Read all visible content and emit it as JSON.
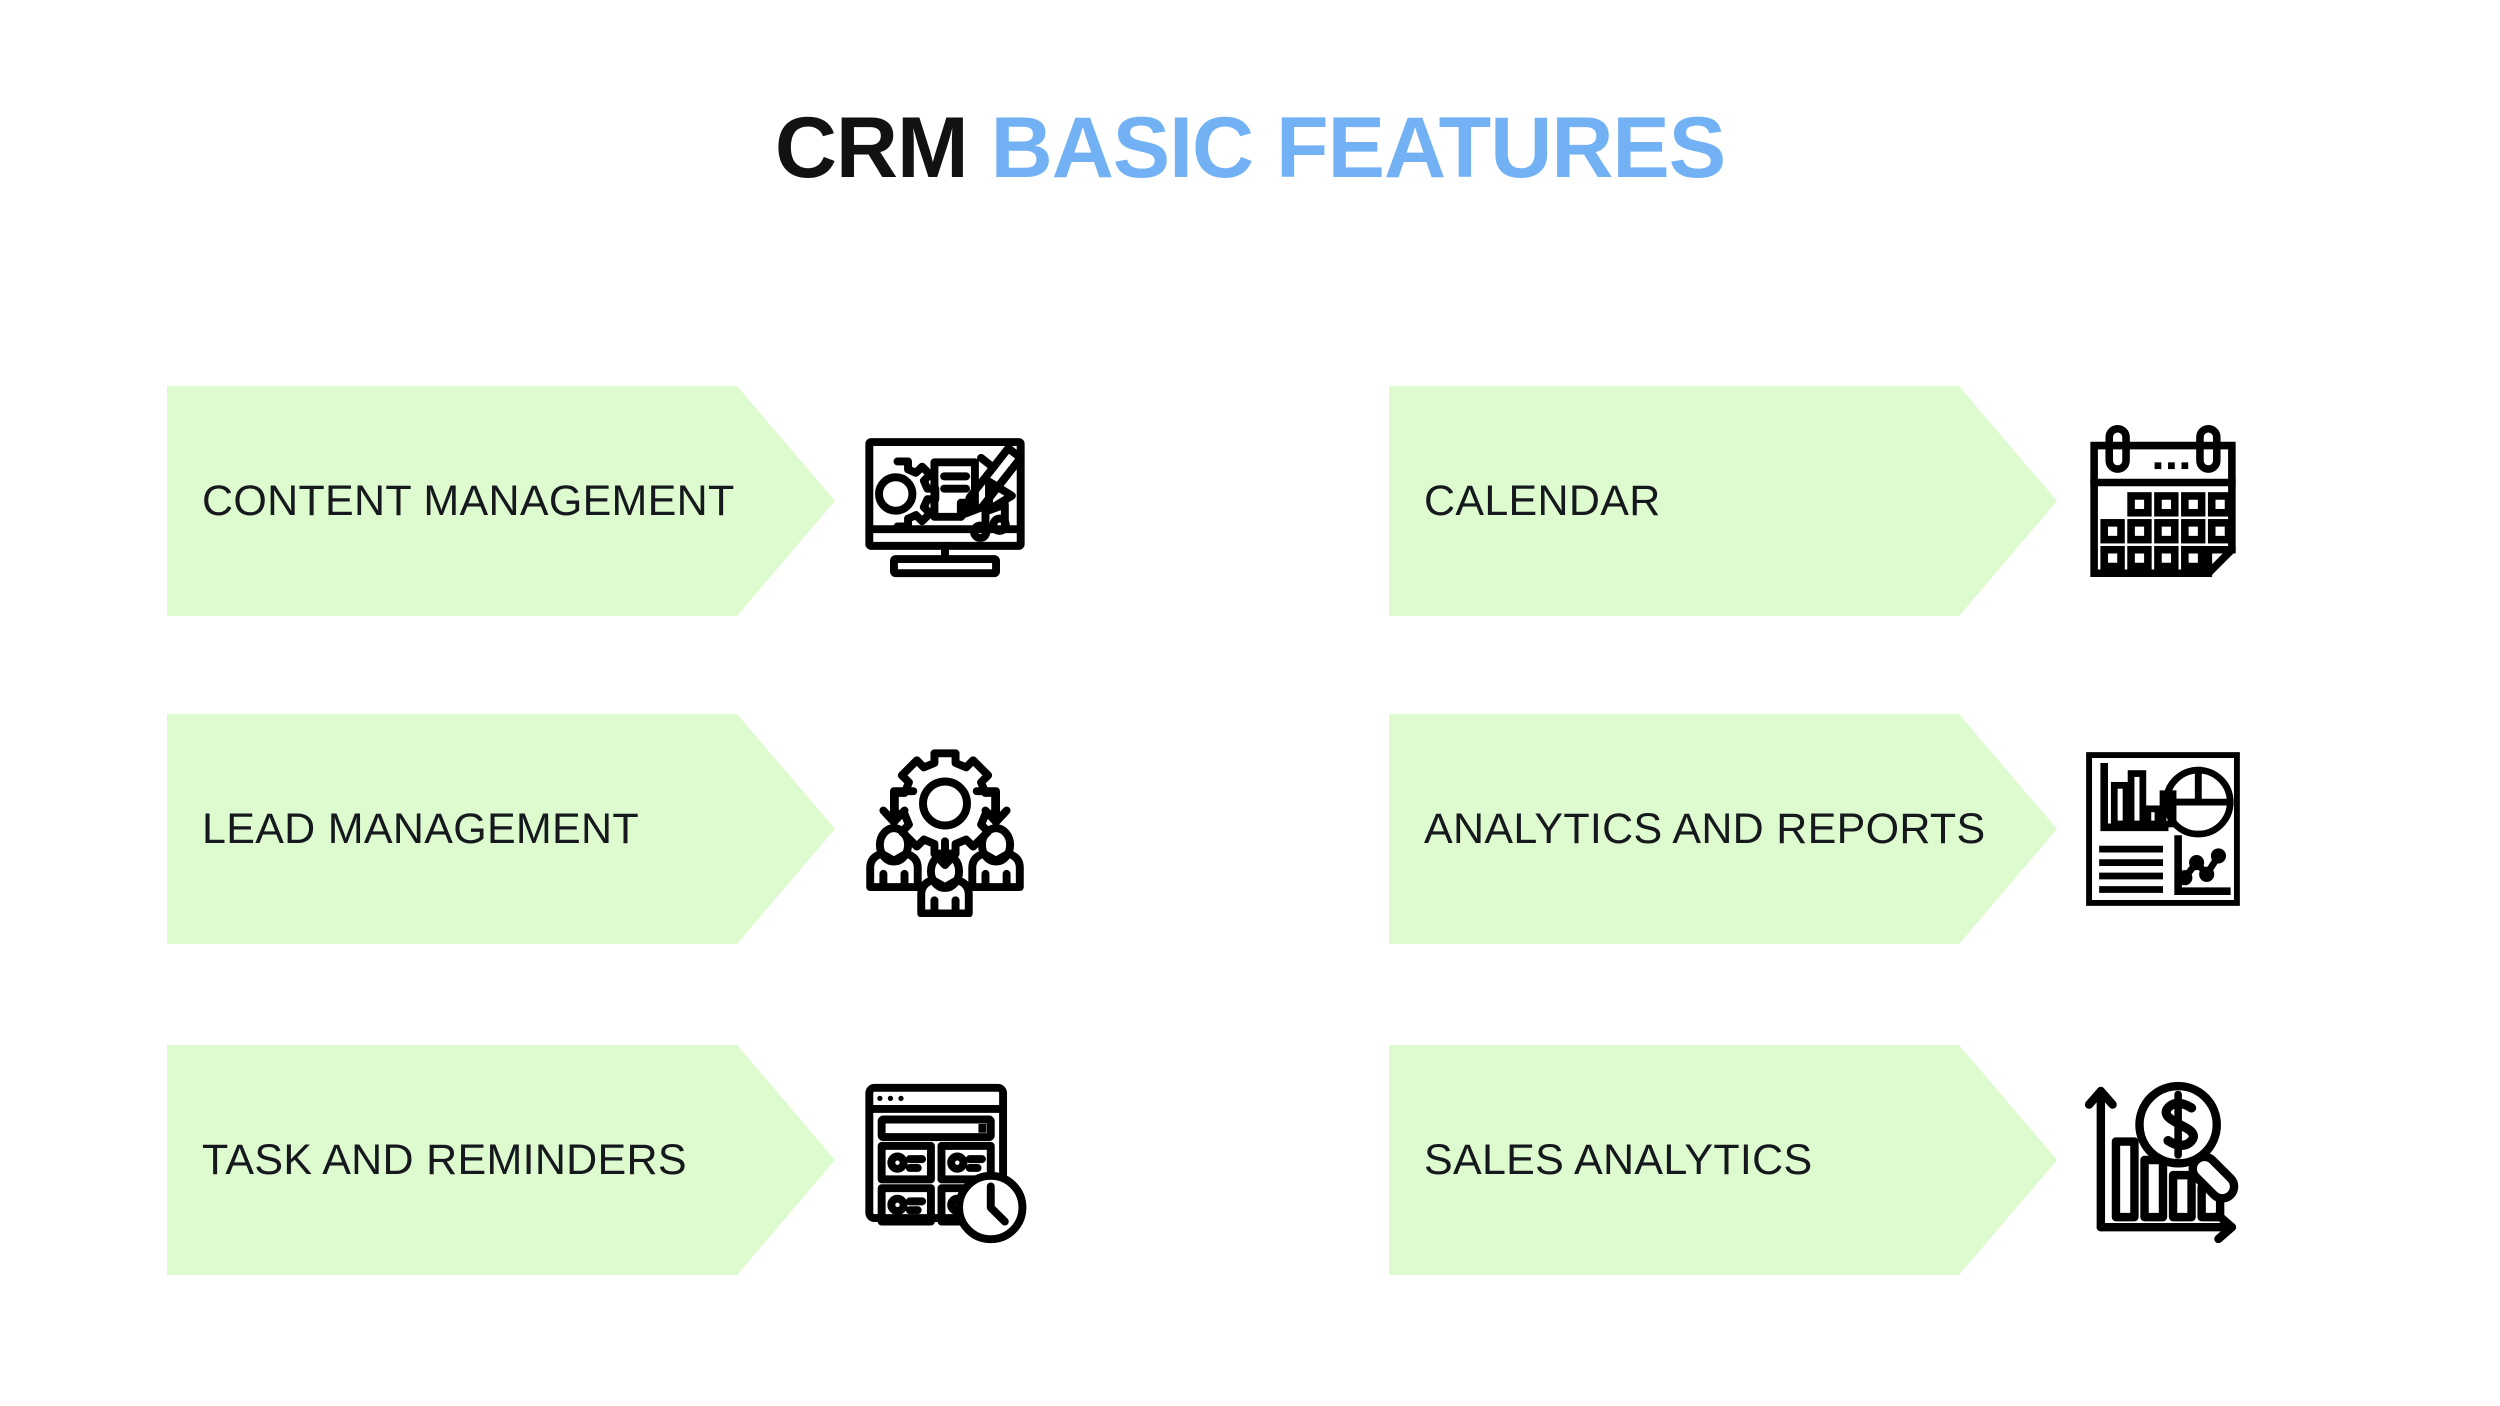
{
  "title": {
    "part_dark": "CRM",
    "part_blue": "BASIC FEATURES",
    "dark_color": "#121212",
    "blue_color": "#72B2F4"
  },
  "theme": {
    "background": "#FFFFFF",
    "banner_fill": "#DEFBCF",
    "banner_text_color": "#15181C",
    "icon_stroke": "#000000"
  },
  "columns": {
    "left": {
      "features": [
        {
          "label": "CONTENT MANAGEMENT",
          "icon": "content-management-icon"
        },
        {
          "label": "LEAD MANAGEMENT",
          "icon": "lead-management-icon"
        },
        {
          "label": "TASK AND REMINDERS",
          "icon": "task-reminders-icon"
        }
      ]
    },
    "right": {
      "features": [
        {
          "label": "CALENDAR",
          "icon": "calendar-icon"
        },
        {
          "label": "ANALYTICS AND REPORTS",
          "icon": "analytics-reports-icon"
        },
        {
          "label": "SALES ANALYTICS",
          "icon": "sales-analytics-icon"
        }
      ]
    }
  }
}
